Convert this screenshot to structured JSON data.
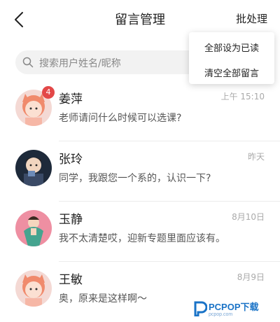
{
  "header": {
    "title": "留言管理",
    "batch_label": "批处理"
  },
  "search": {
    "placeholder": "搜索用户姓名/昵称"
  },
  "menu": {
    "items": [
      "全部设为已读",
      "清空全部留言"
    ]
  },
  "messages": [
    {
      "name": "姜萍",
      "time": "上午 15:10",
      "text": "老师请问什么时候可以选课?",
      "unread": "4",
      "avatar": "girl-cartoon-avatar"
    },
    {
      "name": "张玲",
      "time": "昨天",
      "text": "同学，我跟您一个系的，认识一下?",
      "avatar": "boy-cartoon-avatar"
    },
    {
      "name": "玉静",
      "time": "8月10日",
      "text": "我不太清楚哎，迎新专题里面应该有。",
      "avatar": "green-dress-avatar"
    },
    {
      "name": "王敏",
      "time": "8月9日",
      "text": "奥，原来是这样啊～",
      "avatar": "girl-cartoon-avatar"
    }
  ],
  "watermark": {
    "text": "PCPOP下载",
    "sub": "pcpop.com"
  },
  "colors": {
    "badge": "#e34848",
    "watermark": "#1a73c7"
  }
}
